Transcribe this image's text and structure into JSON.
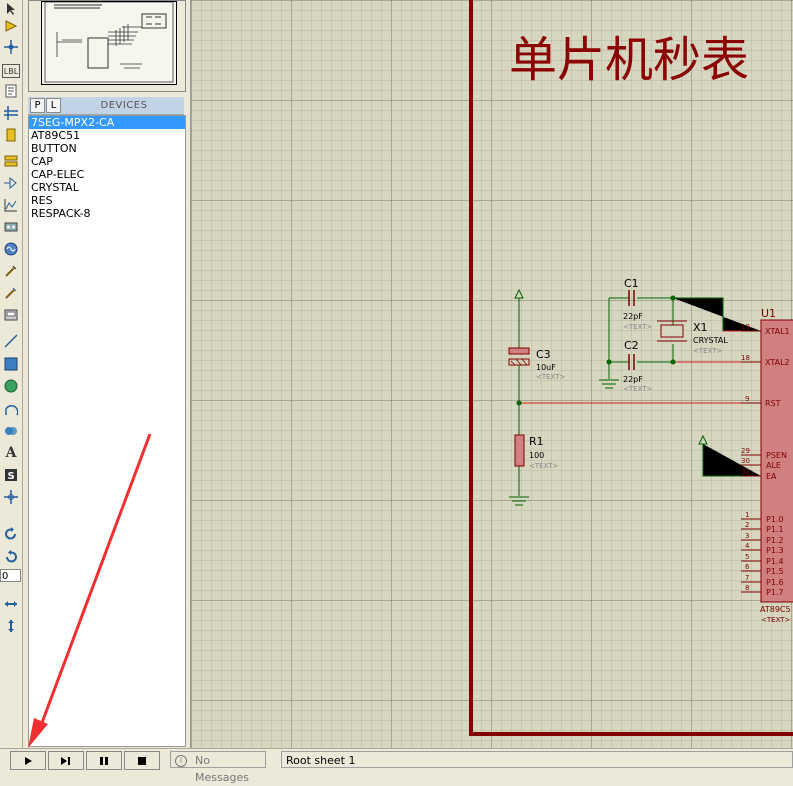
{
  "devices": {
    "header": {
      "p_label": "P",
      "l_label": "L",
      "title": "DEVICES"
    },
    "items": [
      "7SEG-MPX2-CA",
      "AT89C51",
      "BUTTON",
      "CAP",
      "CAP-ELEC",
      "CRYSTAL",
      "RES",
      "RESPACK-8"
    ],
    "selected_index": 0
  },
  "toolbar": {
    "label_tool": "LBL",
    "rotation_value": "0"
  },
  "schematic": {
    "title": "单片机秒表",
    "components": {
      "c1": {
        "ref": "C1",
        "value": "22pF",
        "text": "<TEXT>"
      },
      "c2": {
        "ref": "C2",
        "value": "22pF",
        "text": "<TEXT>"
      },
      "c3": {
        "ref": "C3",
        "value": "10uF",
        "text": "<TEXT>"
      },
      "x1": {
        "ref": "X1",
        "value": "CRYSTAL",
        "text": "<TEXT>"
      },
      "r1": {
        "ref": "R1",
        "value": "100",
        "text": "<TEXT>"
      },
      "u1": {
        "ref": "U1",
        "value": "AT89C5",
        "text": "<TEXT>"
      }
    },
    "u1_pins": [
      {
        "num": "19",
        "name": "XTAL1"
      },
      {
        "num": "18",
        "name": "XTAL2"
      },
      {
        "num": "9",
        "name": "RST"
      },
      {
        "num": "29",
        "name": "PSEN"
      },
      {
        "num": "30",
        "name": "ALE"
      },
      {
        "num": "31",
        "name": "EA"
      },
      {
        "num": "1",
        "name": "P1.0"
      },
      {
        "num": "2",
        "name": "P1.1"
      },
      {
        "num": "3",
        "name": "P1.2"
      },
      {
        "num": "4",
        "name": "P1.3"
      },
      {
        "num": "5",
        "name": "P1.4"
      },
      {
        "num": "6",
        "name": "P1.5"
      },
      {
        "num": "7",
        "name": "P1.6"
      },
      {
        "num": "8",
        "name": "P1.7"
      }
    ]
  },
  "status": {
    "messages": "No Messages",
    "sheet": "Root sheet 1"
  },
  "colors": {
    "wire": "#d42020",
    "frame": "#800000",
    "component": "#8b0000",
    "junction": "#006400",
    "canvas": "#d7d6c1",
    "selection": "#3399ff"
  }
}
